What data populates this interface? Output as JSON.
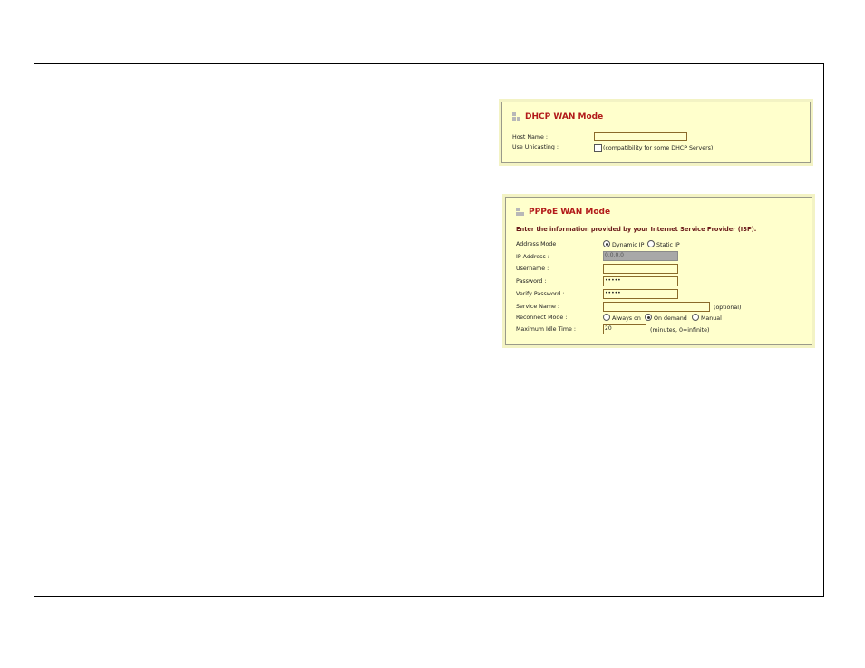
{
  "dhcp": {
    "title": "DHCP WAN Mode",
    "host_name_label": "Host Name :",
    "host_name_value": "",
    "unicasting_label": "Use Unicasting :",
    "unicasting_note": "(compatibility for some DHCP Servers)",
    "unicasting_checked": false
  },
  "pppoe": {
    "title": "PPPoE WAN Mode",
    "intro": "Enter the information provided by your Internet Service Provider (ISP).",
    "address_mode_label": "Address Mode :",
    "address_mode_options": [
      "Dynamic IP",
      "Static IP"
    ],
    "address_mode_selected": "Dynamic IP",
    "ip_address_label": "IP Address :",
    "ip_address_value": "0.0.0.0",
    "username_label": "Username :",
    "username_value": "",
    "password_label": "Password :",
    "password_value": "•••••",
    "verify_password_label": "Verify Password :",
    "verify_password_value": "•••••",
    "service_name_label": "Service Name :",
    "service_name_value": "",
    "service_name_note": "(optional)",
    "reconnect_mode_label": "Reconnect Mode :",
    "reconnect_mode_options": [
      "Always on",
      "On demand",
      "Manual"
    ],
    "reconnect_mode_selected": "On demand",
    "max_idle_label": "Maximum Idle Time :",
    "max_idle_value": "20",
    "max_idle_note": "(minutes, 0=infinite)"
  },
  "colors": {
    "panel_background": "#ffffcc",
    "title_color": "#b21a1a",
    "field_border": "#8a6a2a"
  }
}
